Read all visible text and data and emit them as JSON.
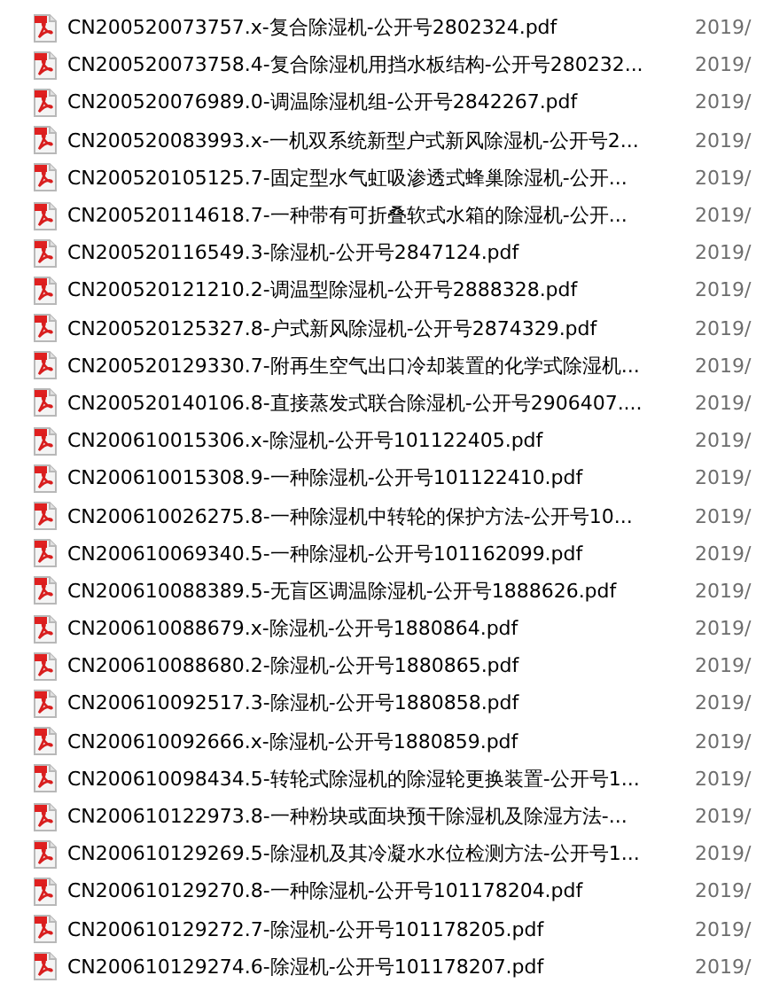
{
  "files": [
    {
      "name": "CN200520073757.x-复合除湿机-公开号2802324.pdf",
      "date": "2019/"
    },
    {
      "name": "CN200520073758.4-复合除湿机用挡水板结构-公开号280232...",
      "date": "2019/"
    },
    {
      "name": "CN200520076989.0-调温除湿机组-公开号2842267.pdf",
      "date": "2019/"
    },
    {
      "name": "CN200520083993.x-一机双系统新型户式新风除湿机-公开号2...",
      "date": "2019/"
    },
    {
      "name": "CN200520105125.7-固定型水气虹吸渗透式蜂巢除湿机-公开...",
      "date": "2019/"
    },
    {
      "name": "CN200520114618.7-一种带有可折叠软式水箱的除湿机-公开...",
      "date": "2019/"
    },
    {
      "name": "CN200520116549.3-除湿机-公开号2847124.pdf",
      "date": "2019/"
    },
    {
      "name": "CN200520121210.2-调温型除湿机-公开号2888328.pdf",
      "date": "2019/"
    },
    {
      "name": "CN200520125327.8-户式新风除湿机-公开号2874329.pdf",
      "date": "2019/"
    },
    {
      "name": "CN200520129330.7-附再生空气出口冷却装置的化学式除湿机...",
      "date": "2019/"
    },
    {
      "name": "CN200520140106.8-直接蒸发式联合除湿机-公开号2906407....",
      "date": "2019/"
    },
    {
      "name": "CN200610015306.x-除湿机-公开号101122405.pdf",
      "date": "2019/"
    },
    {
      "name": "CN200610015308.9-一种除湿机-公开号101122410.pdf",
      "date": "2019/"
    },
    {
      "name": "CN200610026275.8-一种除湿机中转轮的保护方法-公开号10...",
      "date": "2019/"
    },
    {
      "name": "CN200610069340.5-一种除湿机-公开号101162099.pdf",
      "date": "2019/"
    },
    {
      "name": "CN200610088389.5-无盲区调温除湿机-公开号1888626.pdf",
      "date": "2019/"
    },
    {
      "name": "CN200610088679.x-除湿机-公开号1880864.pdf",
      "date": "2019/"
    },
    {
      "name": "CN200610088680.2-除湿机-公开号1880865.pdf",
      "date": "2019/"
    },
    {
      "name": "CN200610092517.3-除湿机-公开号1880858.pdf",
      "date": "2019/"
    },
    {
      "name": "CN200610092666.x-除湿机-公开号1880859.pdf",
      "date": "2019/"
    },
    {
      "name": "CN200610098434.5-转轮式除湿机的除湿轮更换装置-公开号1...",
      "date": "2019/"
    },
    {
      "name": "CN200610122973.8-一种粉块或面块预干除湿机及除湿方法-...",
      "date": "2019/"
    },
    {
      "name": "CN200610129269.5-除湿机及其冷凝水水位检测方法-公开号1...",
      "date": "2019/"
    },
    {
      "name": "CN200610129270.8-一种除湿机-公开号101178204.pdf",
      "date": "2019/"
    },
    {
      "name": "CN200610129272.7-除湿机-公开号101178205.pdf",
      "date": "2019/"
    },
    {
      "name": "CN200610129274.6-除湿机-公开号101178207.pdf",
      "date": "2019/"
    }
  ]
}
